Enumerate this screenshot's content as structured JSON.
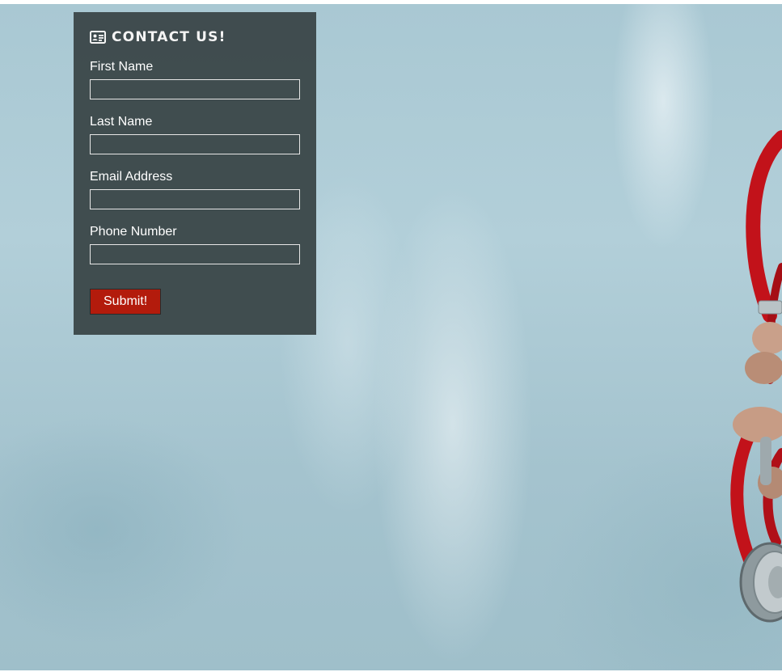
{
  "contact_form": {
    "title": "CONTACT US!",
    "title_icon": "contact-card-icon",
    "fields": [
      {
        "label": "First Name",
        "value": "",
        "placeholder": ""
      },
      {
        "label": "Last Name",
        "value": "",
        "placeholder": ""
      },
      {
        "label": "Email Address",
        "value": "",
        "placeholder": ""
      },
      {
        "label": "Phone Number",
        "value": "",
        "placeholder": ""
      }
    ],
    "submit_label": "Submit!"
  },
  "colors": {
    "panel_background": "#3a4648",
    "submit_button": "#b31b0c",
    "background_sky": "#a9c8d3",
    "stethoscope_tube": "#c2121a"
  }
}
